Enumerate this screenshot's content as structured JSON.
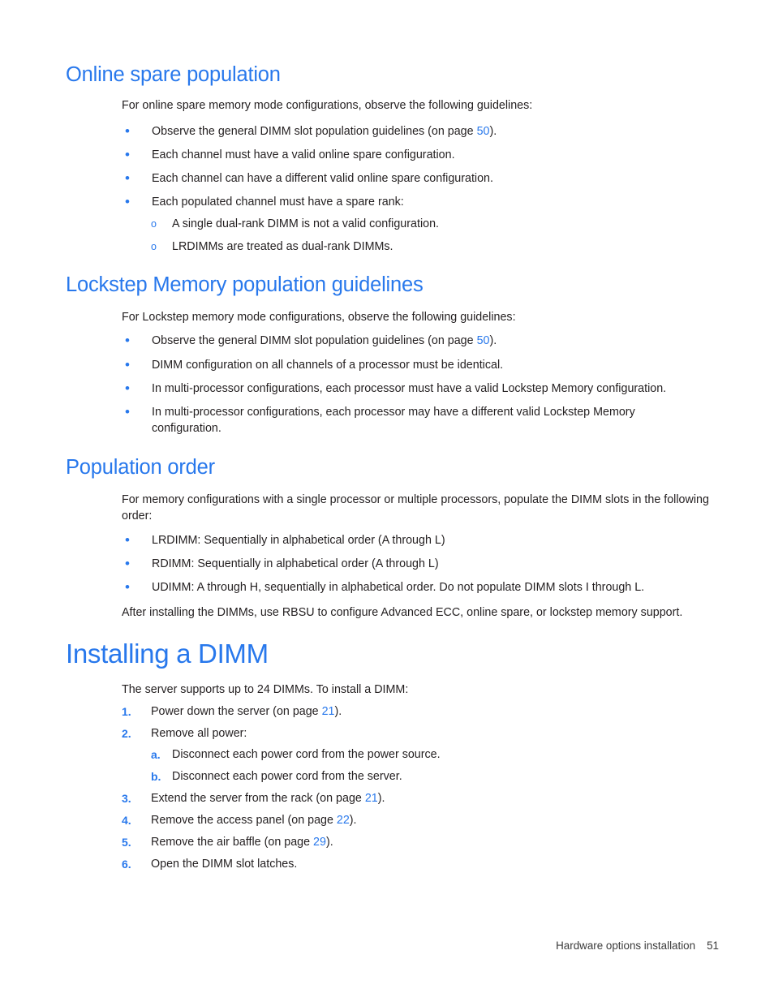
{
  "colors": {
    "heading": "#2878ec",
    "link": "#2878ec",
    "body": "#231f20",
    "background": "#ffffff"
  },
  "sections": [
    {
      "id": "online-spare-population",
      "level": 2,
      "title": "Online spare population",
      "intro": "For online spare memory mode configurations, observe the following guidelines:",
      "bullets": [
        {
          "pre": "Observe the general DIMM slot population guidelines (on page ",
          "link": "50",
          "post": ")."
        },
        {
          "pre": "Each channel must have a valid online spare configuration.",
          "link": "",
          "post": ""
        },
        {
          "pre": "Each channel can have a different valid online spare configuration.",
          "link": "",
          "post": ""
        },
        {
          "pre": "Each populated channel must have a spare rank:",
          "link": "",
          "post": ""
        }
      ],
      "subbullets": [
        "A single dual-rank DIMM is not a valid configuration.",
        "LRDIMMs are treated as dual-rank DIMMs."
      ]
    },
    {
      "id": "lockstep-memory-population-guidelines",
      "level": 2,
      "title": "Lockstep Memory population guidelines",
      "intro": "For Lockstep memory mode configurations, observe the following guidelines:",
      "bullets": [
        {
          "pre": "Observe the general DIMM slot population guidelines (on page ",
          "link": "50",
          "post": ")."
        },
        {
          "pre": "DIMM configuration on all channels of a processor must be identical.",
          "link": "",
          "post": ""
        },
        {
          "pre": "In multi-processor configurations, each processor must have a valid Lockstep Memory configuration.",
          "link": "",
          "post": ""
        },
        {
          "pre": "In multi-processor configurations, each processor may have a different valid Lockstep Memory configuration.",
          "link": "",
          "post": ""
        }
      ]
    },
    {
      "id": "population-order",
      "level": 2,
      "title": "Population order",
      "intro": "For memory configurations with a single processor or multiple processors, populate the DIMM slots in the following order:",
      "bullets": [
        {
          "pre": "LRDIMM: Sequentially in alphabetical order (A through L)",
          "link": "",
          "post": ""
        },
        {
          "pre": "RDIMM: Sequentially in alphabetical order (A through L)",
          "link": "",
          "post": ""
        },
        {
          "pre": "UDIMM: A through H, sequentially in alphabetical order. Do not populate DIMM slots I through L.",
          "link": "",
          "post": ""
        }
      ],
      "outro": "After installing the DIMMs, use RBSU to configure Advanced ECC, online spare, or lockstep memory support."
    },
    {
      "id": "installing-a-dimm",
      "level": 1,
      "title": "Installing a DIMM",
      "intro": "The server supports up to 24 DIMMs. To install a DIMM:",
      "steps": [
        {
          "num": "1.",
          "pre": "Power down the server (on page ",
          "link": "21",
          "post": ")."
        },
        {
          "num": "2.",
          "pre": "Remove all power:",
          "link": "",
          "post": ""
        },
        {
          "num": "3.",
          "pre": "Extend the server from the rack (on page ",
          "link": "21",
          "post": ")."
        },
        {
          "num": "4.",
          "pre": "Remove the access panel (on page ",
          "link": "22",
          "post": ")."
        },
        {
          "num": "5.",
          "pre": "Remove the air baffle (on page ",
          "link": "29",
          "post": ")."
        },
        {
          "num": "6.",
          "pre": "Open the DIMM slot latches.",
          "link": "",
          "post": ""
        }
      ],
      "substeps": [
        {
          "letter": "a.",
          "text": "Disconnect each power cord from the power source."
        },
        {
          "letter": "b.",
          "text": "Disconnect each power cord from the server."
        }
      ]
    }
  ],
  "bullet_glyph": "•",
  "subbullet_glyph": "o",
  "footer": {
    "section_name": "Hardware options installation",
    "page_number": "51"
  }
}
